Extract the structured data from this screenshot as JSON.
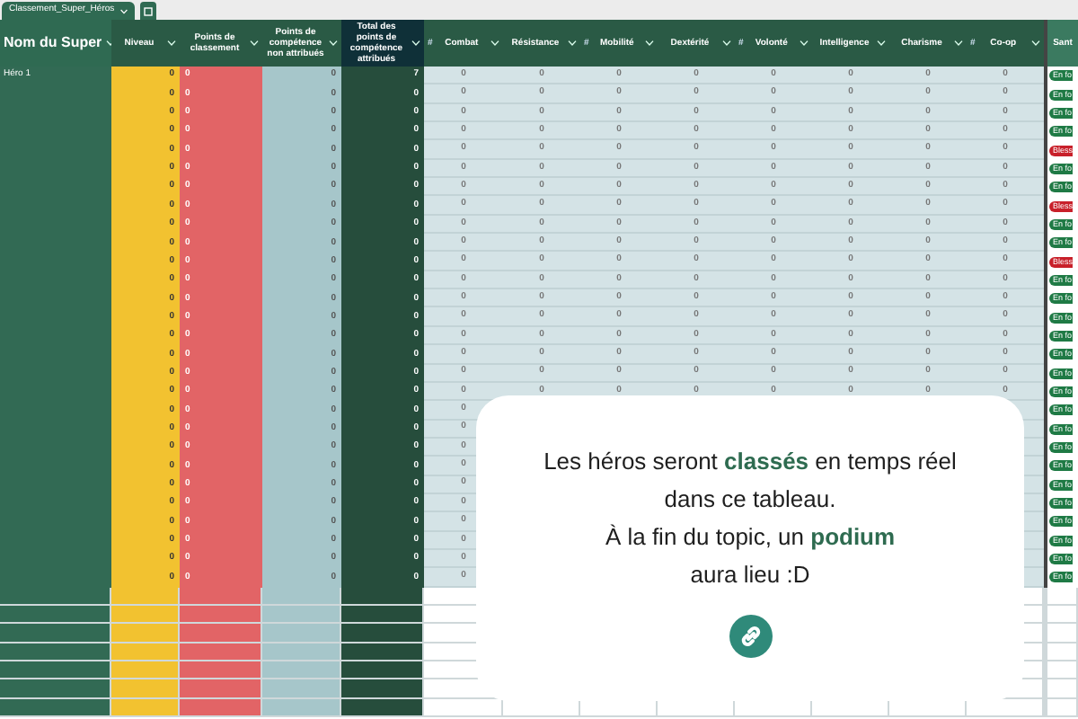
{
  "sheet_tabs": [
    {
      "label": "Classement_Super_Héros",
      "selected": true
    }
  ],
  "table": {
    "columns": [
      {
        "label": "Nom du Super"
      },
      {
        "label": "Niveau"
      },
      {
        "label": "Points de classement"
      },
      {
        "label": "Points de compétence non attribués"
      },
      {
        "label": "Total des points de compétence attribués"
      },
      {
        "label": "Combat",
        "type_mark": "#"
      },
      {
        "label": "Résistance"
      },
      {
        "label": "Mobilité",
        "type_mark": "#"
      },
      {
        "label": "Dextérité"
      },
      {
        "label": "Volonté",
        "type_mark": "#"
      },
      {
        "label": "Intelligence"
      },
      {
        "label": "Charisme"
      },
      {
        "label": "Co-op",
        "type_mark": "#"
      },
      {
        "label": "Sant"
      }
    ],
    "rows": [
      {
        "name": "Héro 1",
        "values": [
          "0",
          "0",
          "0",
          "7",
          "0",
          "0",
          "0",
          "0",
          "0",
          "0",
          "0",
          "0"
        ],
        "status": {
          "text": "En fo",
          "color": "#1f7a45"
        }
      },
      {
        "name": "",
        "values": [
          "0",
          "0",
          "0",
          "0",
          "0",
          "0",
          "0",
          "0",
          "0",
          "0",
          "0",
          "0"
        ],
        "status": {
          "text": "En fo",
          "color": "#1f7a45"
        }
      },
      {
        "name": "",
        "values": [
          "0",
          "0",
          "0",
          "0",
          "0",
          "0",
          "0",
          "0",
          "0",
          "0",
          "0",
          "0"
        ],
        "status": {
          "text": "En fo",
          "color": "#1f7a45"
        }
      },
      {
        "name": "",
        "values": [
          "0",
          "0",
          "0",
          "0",
          "0",
          "0",
          "0",
          "0",
          "0",
          "0",
          "0",
          "0"
        ],
        "status": {
          "text": "En fo",
          "color": "#1f7a45"
        }
      },
      {
        "name": "",
        "values": [
          "0",
          "0",
          "0",
          "0",
          "0",
          "0",
          "0",
          "0",
          "0",
          "0",
          "0",
          "0"
        ],
        "status": {
          "text": "Bless",
          "color": "#c8202a"
        }
      },
      {
        "name": "",
        "values": [
          "0",
          "0",
          "0",
          "0",
          "0",
          "0",
          "0",
          "0",
          "0",
          "0",
          "0",
          "0"
        ],
        "status": {
          "text": "En fo",
          "color": "#1f7a45"
        }
      },
      {
        "name": "",
        "values": [
          "0",
          "0",
          "0",
          "0",
          "0",
          "0",
          "0",
          "0",
          "0",
          "0",
          "0",
          "0"
        ],
        "status": {
          "text": "En fo",
          "color": "#1f7a45"
        }
      },
      {
        "name": "",
        "values": [
          "0",
          "0",
          "0",
          "0",
          "0",
          "0",
          "0",
          "0",
          "0",
          "0",
          "0",
          "0"
        ],
        "status": {
          "text": "Bless",
          "color": "#c8202a"
        }
      },
      {
        "name": "",
        "values": [
          "0",
          "0",
          "0",
          "0",
          "0",
          "0",
          "0",
          "0",
          "0",
          "0",
          "0",
          "0"
        ],
        "status": {
          "text": "En fo",
          "color": "#1f7a45"
        }
      },
      {
        "name": "",
        "values": [
          "0",
          "0",
          "0",
          "0",
          "0",
          "0",
          "0",
          "0",
          "0",
          "0",
          "0",
          "0"
        ],
        "status": {
          "text": "En fo",
          "color": "#1f7a45"
        }
      },
      {
        "name": "",
        "values": [
          "0",
          "0",
          "0",
          "0",
          "0",
          "0",
          "0",
          "0",
          "0",
          "0",
          "0",
          "0"
        ],
        "status": {
          "text": "Bless",
          "color": "#c8202a"
        }
      },
      {
        "name": "",
        "values": [
          "0",
          "0",
          "0",
          "0",
          "0",
          "0",
          "0",
          "0",
          "0",
          "0",
          "0",
          "0"
        ],
        "status": {
          "text": "En fo",
          "color": "#1f7a45"
        }
      },
      {
        "name": "",
        "values": [
          "0",
          "0",
          "0",
          "0",
          "0",
          "0",
          "0",
          "0",
          "0",
          "0",
          "0",
          "0"
        ],
        "status": {
          "text": "En fo",
          "color": "#1f7a45"
        }
      },
      {
        "name": "",
        "values": [
          "0",
          "0",
          "0",
          "0",
          "0",
          "0",
          "0",
          "0",
          "0",
          "0",
          "0",
          "0"
        ],
        "status": {
          "text": "En fo",
          "color": "#1f7a45"
        }
      },
      {
        "name": "",
        "values": [
          "0",
          "0",
          "0",
          "0",
          "0",
          "0",
          "0",
          "0",
          "0",
          "0",
          "0",
          "0"
        ],
        "status": {
          "text": "En fo",
          "color": "#1f7a45"
        }
      },
      {
        "name": "",
        "values": [
          "0",
          "0",
          "0",
          "0",
          "0",
          "0",
          "0",
          "0",
          "0",
          "0",
          "0",
          "0"
        ],
        "status": {
          "text": "En fo",
          "color": "#1f7a45"
        }
      },
      {
        "name": "",
        "values": [
          "0",
          "0",
          "0",
          "0",
          "0",
          "0",
          "0",
          "0",
          "0",
          "0",
          "0",
          "0"
        ],
        "status": {
          "text": "En fo",
          "color": "#1f7a45"
        }
      },
      {
        "name": "",
        "values": [
          "0",
          "0",
          "0",
          "0",
          "0",
          "0",
          "0",
          "0",
          "0",
          "0",
          "0",
          "0"
        ],
        "status": {
          "text": "En fo",
          "color": "#1f7a45"
        }
      },
      {
        "name": "",
        "values": [
          "0",
          "0",
          "0",
          "0",
          "0"
        ],
        "status": {
          "text": "En fo",
          "color": "#1f7a45"
        }
      },
      {
        "name": "",
        "values": [
          "0",
          "0",
          "0",
          "0",
          "0"
        ],
        "status": {
          "text": "En fo",
          "color": "#1f7a45"
        }
      },
      {
        "name": "",
        "values": [
          "0",
          "0",
          "0",
          "0",
          "0"
        ],
        "status": {
          "text": "En fo",
          "color": "#1f7a45"
        }
      },
      {
        "name": "",
        "values": [
          "0",
          "0",
          "0",
          "0",
          "0"
        ],
        "status": {
          "text": "En fo",
          "color": "#1f7a45"
        }
      },
      {
        "name": "",
        "values": [
          "0",
          "0",
          "0",
          "0",
          "0"
        ],
        "status": {
          "text": "En fo",
          "color": "#1f7a45"
        }
      },
      {
        "name": "",
        "values": [
          "0",
          "0",
          "0",
          "0",
          "0"
        ],
        "status": {
          "text": "En fo",
          "color": "#1f7a45"
        }
      },
      {
        "name": "",
        "values": [
          "0",
          "0",
          "0",
          "0",
          "0"
        ],
        "status": {
          "text": "En fo",
          "color": "#1f7a45"
        }
      },
      {
        "name": "",
        "values": [
          "0",
          "0",
          "0",
          "0",
          "0"
        ],
        "status": {
          "text": "En fo",
          "color": "#1f7a45"
        }
      },
      {
        "name": "",
        "values": [
          "0",
          "0",
          "0",
          "0",
          "0"
        ],
        "status": {
          "text": "En fo",
          "color": "#1f7a45"
        }
      },
      {
        "name": "",
        "values": [
          "0",
          "0",
          "0",
          "0",
          "0"
        ],
        "status": {
          "text": "En fo",
          "color": "#1f7a45"
        }
      }
    ]
  },
  "overlay_card": {
    "paragraphs": [
      "Les héros seront **classés** en temps réel dans ce tableau.",
      "À la fin du topic, un **podium** aura lieu :D"
    ]
  }
}
